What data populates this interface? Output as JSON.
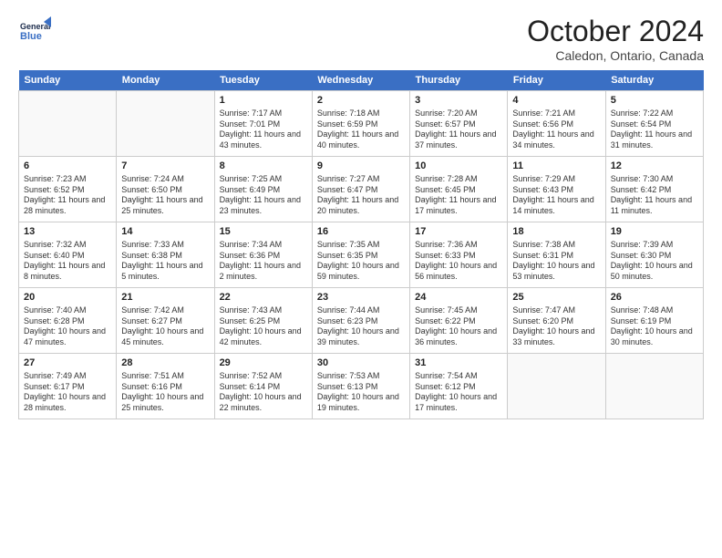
{
  "header": {
    "logo_general": "General",
    "logo_blue": "Blue",
    "month": "October 2024",
    "location": "Caledon, Ontario, Canada"
  },
  "weekdays": [
    "Sunday",
    "Monday",
    "Tuesday",
    "Wednesday",
    "Thursday",
    "Friday",
    "Saturday"
  ],
  "weeks": [
    [
      {
        "day": "",
        "info": ""
      },
      {
        "day": "",
        "info": ""
      },
      {
        "day": "1",
        "info": "Sunrise: 7:17 AM\nSunset: 7:01 PM\nDaylight: 11 hours and 43 minutes."
      },
      {
        "day": "2",
        "info": "Sunrise: 7:18 AM\nSunset: 6:59 PM\nDaylight: 11 hours and 40 minutes."
      },
      {
        "day": "3",
        "info": "Sunrise: 7:20 AM\nSunset: 6:57 PM\nDaylight: 11 hours and 37 minutes."
      },
      {
        "day": "4",
        "info": "Sunrise: 7:21 AM\nSunset: 6:56 PM\nDaylight: 11 hours and 34 minutes."
      },
      {
        "day": "5",
        "info": "Sunrise: 7:22 AM\nSunset: 6:54 PM\nDaylight: 11 hours and 31 minutes."
      }
    ],
    [
      {
        "day": "6",
        "info": "Sunrise: 7:23 AM\nSunset: 6:52 PM\nDaylight: 11 hours and 28 minutes."
      },
      {
        "day": "7",
        "info": "Sunrise: 7:24 AM\nSunset: 6:50 PM\nDaylight: 11 hours and 25 minutes."
      },
      {
        "day": "8",
        "info": "Sunrise: 7:25 AM\nSunset: 6:49 PM\nDaylight: 11 hours and 23 minutes."
      },
      {
        "day": "9",
        "info": "Sunrise: 7:27 AM\nSunset: 6:47 PM\nDaylight: 11 hours and 20 minutes."
      },
      {
        "day": "10",
        "info": "Sunrise: 7:28 AM\nSunset: 6:45 PM\nDaylight: 11 hours and 17 minutes."
      },
      {
        "day": "11",
        "info": "Sunrise: 7:29 AM\nSunset: 6:43 PM\nDaylight: 11 hours and 14 minutes."
      },
      {
        "day": "12",
        "info": "Sunrise: 7:30 AM\nSunset: 6:42 PM\nDaylight: 11 hours and 11 minutes."
      }
    ],
    [
      {
        "day": "13",
        "info": "Sunrise: 7:32 AM\nSunset: 6:40 PM\nDaylight: 11 hours and 8 minutes."
      },
      {
        "day": "14",
        "info": "Sunrise: 7:33 AM\nSunset: 6:38 PM\nDaylight: 11 hours and 5 minutes."
      },
      {
        "day": "15",
        "info": "Sunrise: 7:34 AM\nSunset: 6:36 PM\nDaylight: 11 hours and 2 minutes."
      },
      {
        "day": "16",
        "info": "Sunrise: 7:35 AM\nSunset: 6:35 PM\nDaylight: 10 hours and 59 minutes."
      },
      {
        "day": "17",
        "info": "Sunrise: 7:36 AM\nSunset: 6:33 PM\nDaylight: 10 hours and 56 minutes."
      },
      {
        "day": "18",
        "info": "Sunrise: 7:38 AM\nSunset: 6:31 PM\nDaylight: 10 hours and 53 minutes."
      },
      {
        "day": "19",
        "info": "Sunrise: 7:39 AM\nSunset: 6:30 PM\nDaylight: 10 hours and 50 minutes."
      }
    ],
    [
      {
        "day": "20",
        "info": "Sunrise: 7:40 AM\nSunset: 6:28 PM\nDaylight: 10 hours and 47 minutes."
      },
      {
        "day": "21",
        "info": "Sunrise: 7:42 AM\nSunset: 6:27 PM\nDaylight: 10 hours and 45 minutes."
      },
      {
        "day": "22",
        "info": "Sunrise: 7:43 AM\nSunset: 6:25 PM\nDaylight: 10 hours and 42 minutes."
      },
      {
        "day": "23",
        "info": "Sunrise: 7:44 AM\nSunset: 6:23 PM\nDaylight: 10 hours and 39 minutes."
      },
      {
        "day": "24",
        "info": "Sunrise: 7:45 AM\nSunset: 6:22 PM\nDaylight: 10 hours and 36 minutes."
      },
      {
        "day": "25",
        "info": "Sunrise: 7:47 AM\nSunset: 6:20 PM\nDaylight: 10 hours and 33 minutes."
      },
      {
        "day": "26",
        "info": "Sunrise: 7:48 AM\nSunset: 6:19 PM\nDaylight: 10 hours and 30 minutes."
      }
    ],
    [
      {
        "day": "27",
        "info": "Sunrise: 7:49 AM\nSunset: 6:17 PM\nDaylight: 10 hours and 28 minutes."
      },
      {
        "day": "28",
        "info": "Sunrise: 7:51 AM\nSunset: 6:16 PM\nDaylight: 10 hours and 25 minutes."
      },
      {
        "day": "29",
        "info": "Sunrise: 7:52 AM\nSunset: 6:14 PM\nDaylight: 10 hours and 22 minutes."
      },
      {
        "day": "30",
        "info": "Sunrise: 7:53 AM\nSunset: 6:13 PM\nDaylight: 10 hours and 19 minutes."
      },
      {
        "day": "31",
        "info": "Sunrise: 7:54 AM\nSunset: 6:12 PM\nDaylight: 10 hours and 17 minutes."
      },
      {
        "day": "",
        "info": ""
      },
      {
        "day": "",
        "info": ""
      }
    ]
  ]
}
